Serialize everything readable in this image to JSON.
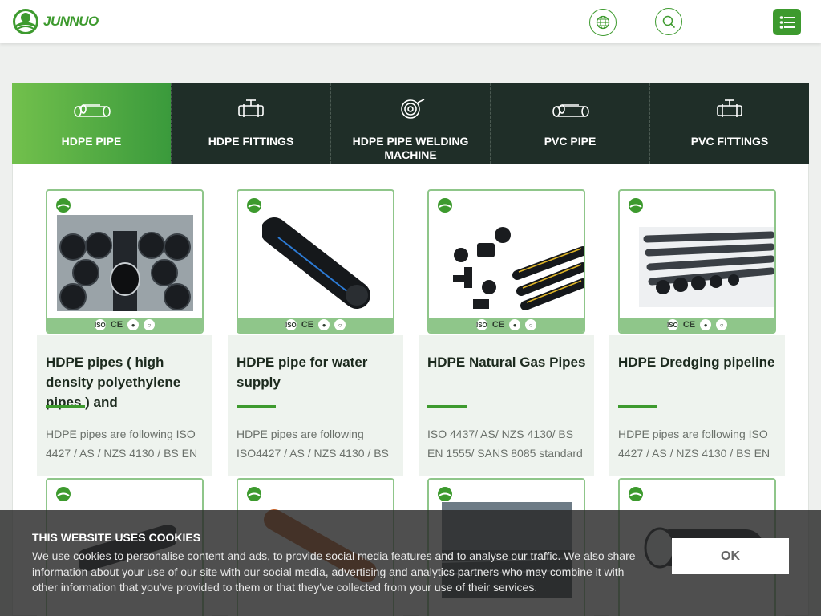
{
  "header": {
    "brand": "JUNNUO",
    "brand_color": "#3d9a2e",
    "icons": {
      "language": "globe-icon",
      "search": "search-icon",
      "menu": "list-menu-icon"
    }
  },
  "tabs": [
    {
      "label": "HDPE PIPE",
      "icon": "pipe-icon",
      "active": true
    },
    {
      "label": "HDPE FITTINGS",
      "icon": "fitting-icon",
      "active": false
    },
    {
      "label": "HDPE PIPE WELDING MACHINE",
      "icon": "pipe-coil-icon",
      "active": false
    },
    {
      "label": "PVC PIPE",
      "icon": "pipe-icon",
      "active": false
    },
    {
      "label": "PVC FITTINGS",
      "icon": "fitting-icon",
      "active": false
    }
  ],
  "products": [
    {
      "title": "HDPE pipes ( high density polyethylene pipes ) and",
      "desc": "HDPE pipes are following ISO 4427 / AS / NZS 4130 / BS EN"
    },
    {
      "title": "HDPE pipe for water supply",
      "desc": "HDPE pipes are following ISO4427 / AS / NZS 4130 / BS"
    },
    {
      "title": "HDPE Natural Gas Pipes",
      "desc": "ISO 4437/ AS/ NZS 4130/ BS EN 1555/ SANS 8085 standard"
    },
    {
      "title": "HDPE Dredging pipeline",
      "desc": "HDPE pipes are following ISO 4427 / AS / NZS 4130 / BS EN"
    }
  ],
  "certs": [
    "ISO",
    "CE"
  ],
  "cookie": {
    "title": "THIS WEBSITE USES COOKIES",
    "text": "We use cookies to personalise content and ads, to provide social media features and to analyse our traffic. We also share information about your use of our site with our social media, advertising and analytics partners who may combine it with other information that you've provided to them or that they've collected from your use of their services.",
    "ok_label": "OK"
  }
}
